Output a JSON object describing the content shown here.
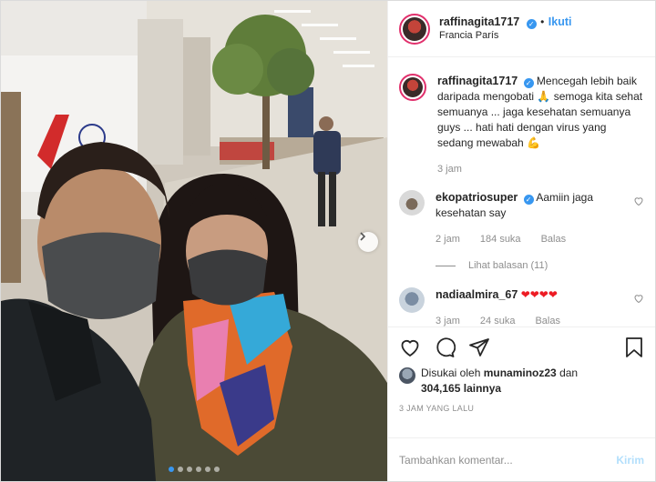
{
  "header": {
    "username": "raffinagita1717",
    "separator": "•",
    "follow_label": "Ikuti",
    "location": "Francia París"
  },
  "caption": {
    "username": "raffinagita1717",
    "text": "Mencegah lebih baik daripada mengobati 🙏 semoga kita sehat semuanya ... jaga kesehatan semuanya guys ... hati hati dengan virus yang sedang mewabah 💪",
    "time": "3 jam"
  },
  "comments": [
    {
      "username": "ekopatriosuper",
      "text": "Aamiin jaga kesehatan say",
      "time": "2 jam",
      "likes": "184 suka",
      "reply_label": "Balas",
      "view_replies": "Lihat balasan (11)"
    },
    {
      "username": "nadiaalmira_67",
      "text": "❤❤❤❤",
      "time": "3 jam",
      "likes": "24 suka",
      "reply_label": "Balas"
    }
  ],
  "likes": {
    "prefix": "Disukai oleh",
    "user": "munaminoz23",
    "middle": "dan",
    "count": "304,165",
    "suffix": "lainnya"
  },
  "posted": "3 JAM YANG LALU",
  "add_comment": {
    "placeholder": "Tambahkan komentar...",
    "post_label": "Kirim"
  },
  "carousel": {
    "total": 6,
    "active": 0
  },
  "colors": {
    "accent": "#3897f0",
    "heart": "#ed1c24",
    "ring": "#e1306c"
  },
  "icons": [
    "verified-badge-icon",
    "heart-icon",
    "comment-icon",
    "share-icon",
    "bookmark-icon",
    "chevron-right-icon"
  ]
}
